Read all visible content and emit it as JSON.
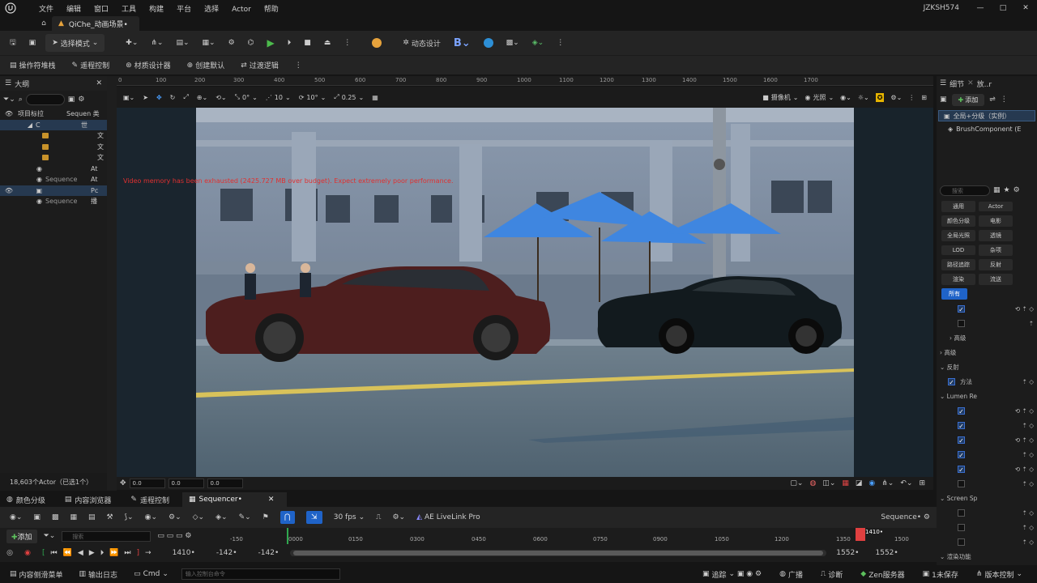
{
  "menubar": {
    "items": [
      "文件",
      "编辑",
      "窗口",
      "工具",
      "构建",
      "平台",
      "选择",
      "Actor",
      "帮助"
    ],
    "user": "JZKSH574",
    "window_controls": [
      "—",
      "□",
      "✕"
    ]
  },
  "tab": {
    "level_name": "QiChe_动画场景•"
  },
  "toolbar1": {
    "mode_label": "选择模式",
    "dynamic_design": "动态设计"
  },
  "toolbar2": {
    "items": [
      "操作符堆栈",
      "遥程控制",
      "材质设计器",
      "创建默认",
      "过渡逻辑"
    ]
  },
  "outliner": {
    "title": "大纲",
    "rows": [
      {
        "label": "项目标拉",
        "extra": "Sequen 类",
        "sel": false
      },
      {
        "label": "C",
        "extra": "世",
        "sel": true
      },
      {
        "label": "",
        "extra": "文",
        "sel": false
      },
      {
        "label": "",
        "extra": "文",
        "sel": false
      },
      {
        "label": "",
        "extra": "文",
        "sel": false
      },
      {
        "label": "",
        "extra": "At",
        "sel": false
      },
      {
        "label": "Sequence",
        "extra": "At",
        "sel": false
      },
      {
        "label": "",
        "extra": "Pc",
        "sel": true
      },
      {
        "label": "Sequence",
        "extra": "播",
        "sel": false
      }
    ],
    "footer": "18,603个Actor（已选1个）"
  },
  "ruler": {
    "ticks": [
      "0",
      "100",
      "200",
      "300",
      "400",
      "500",
      "600",
      "700",
      "800",
      "900",
      "1000",
      "1100",
      "1200",
      "1300",
      "1400",
      "1500",
      "1600",
      "1700"
    ]
  },
  "viewport": {
    "angle": "0°",
    "grid": "10",
    "rot": "10°",
    "scale": "0.25",
    "camera": "摄像机",
    "lit": "光照",
    "warning": "Video memory has been exhausted (2425.727 MB over budget). Expect extremely poor performance.",
    "coords": [
      "0.0",
      "0.0",
      "0.0"
    ]
  },
  "details": {
    "tabs": [
      "细节",
      "放..r"
    ],
    "add_label": "添加",
    "component_root": "全局+分级（实例）",
    "component_child": "BrushComponent (E",
    "search_placeholder": "搜索",
    "filters": [
      [
        "通用",
        "Actor"
      ],
      [
        "颜色分级",
        "电影"
      ],
      [
        "全局光照",
        "透镜"
      ],
      [
        "LOD",
        "杂项"
      ],
      [
        "路径追踪",
        "反射"
      ],
      [
        "渲染",
        "流送"
      ],
      [
        "所有"
      ]
    ],
    "sections": [
      "高级",
      "高级",
      "反射",
      "方法",
      "Lumen Re",
      "Screen Sp",
      "渲染功能"
    ]
  },
  "bottom_tabs": [
    "颜色分级",
    "内容浏览器",
    "遥程控制",
    "Sequencer•"
  ],
  "sequencer": {
    "fps": "30 fps",
    "livelink": "AE LiveLink Pro",
    "seq_name": "Sequence•",
    "add_label": "添加",
    "search_placeholder": "搜索",
    "timeline_ticks": [
      "-150",
      "0000",
      "0150",
      "0300",
      "0450",
      "0600",
      "0750",
      "0900",
      "1050",
      "1200",
      "1350",
      "1500"
    ],
    "playhead": "1410•",
    "current_frame": "1410•",
    "range_start": "-142•",
    "range_start2": "-142•",
    "range_end": "1552•",
    "range_end2": "1552•"
  },
  "status": {
    "items": [
      "内容侧滑菜单",
      "输出日志",
      "Cmd"
    ],
    "cmd_placeholder": "输入控制台命令",
    "right": [
      "追踪",
      "广播",
      "诊断",
      "Zen服务器",
      "1未保存",
      "版本控制"
    ]
  }
}
